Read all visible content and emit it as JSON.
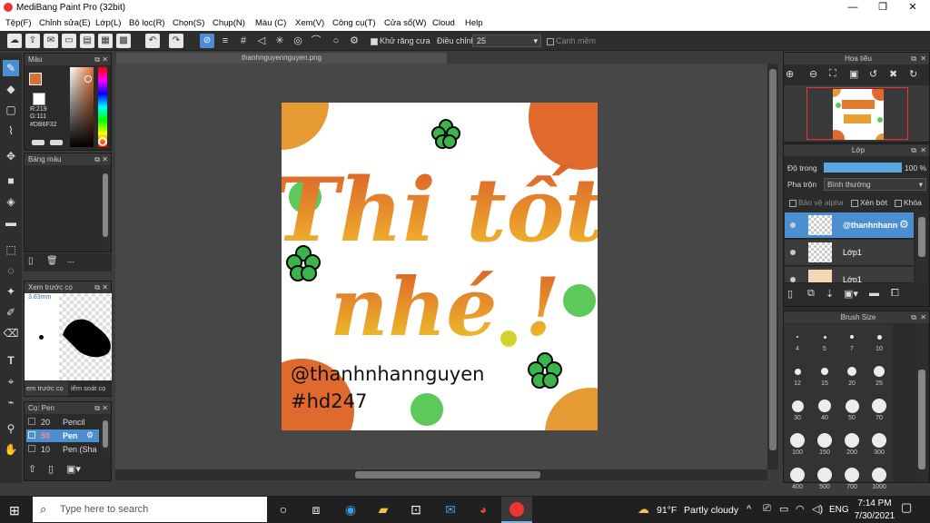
{
  "window": {
    "title": "MediBang Paint Pro (32bit)",
    "min": "—",
    "max": "❐",
    "close": "✕"
  },
  "menu": [
    "Tệp(F)",
    "Chỉnh sửa(E)",
    "Lớp(L)",
    "Bộ lọc(R)",
    "Chọn(S)",
    "Chụp(N)",
    "Màu (C)",
    "Xem(V)",
    "Công cụ(T)",
    "Cửa sổ(W)",
    "Cloud",
    "Help"
  ],
  "toolbar": {
    "antialias": "Khử răng cưa",
    "adjust_label": "Điều chỉnh",
    "adjust_value": "25",
    "edge": "Cạnh mềm"
  },
  "color_panel": {
    "title": "Màu",
    "r": "R:219",
    "g": "G:111",
    "hex": "#DB6F32",
    "fg": "#db6f32"
  },
  "swatch_panel": {
    "title": "Bảng màu",
    "dash": "---"
  },
  "brush_preview": {
    "title": "Xem trước cọ",
    "size": "3.63mm",
    "tab1": "em trước cọ",
    "tab2": "iểm soát cọ"
  },
  "brush_list": {
    "title": "Cọ: Pen",
    "items": [
      {
        "size": "20",
        "name": "Pencil"
      },
      {
        "size": "50",
        "name": "Pen"
      },
      {
        "size": "10",
        "name": "Pen (Sha"
      }
    ]
  },
  "document": {
    "tab": "thanhnguyennguyen.png",
    "art_line1": "Thi tốt",
    "art_line2": "nhé !",
    "handle": "@thanhnhannguyen",
    "tag": "#hd247"
  },
  "navigator": {
    "title": "Hoa tiêu"
  },
  "layers": {
    "title": "Lớp",
    "opacity_label": "Độ trong",
    "opacity_value": "100 %",
    "opacity": 1.0,
    "blend_label": "Pha trộn",
    "blend_value": "Bình thường",
    "protect_alpha": "Bảo vệ alpha",
    "clipping": "Xén bớt",
    "lock": "Khóa",
    "rows": [
      "@thanhnhann",
      "Lớp1",
      "Lớp1"
    ]
  },
  "brush_size": {
    "title": "Brush Size",
    "sizes": [
      "4",
      "5",
      "7",
      "10",
      "12",
      "15",
      "20",
      "25",
      "30",
      "40",
      "50",
      "70",
      "100",
      "150",
      "200",
      "300",
      "400",
      "500",
      "700",
      "1000"
    ]
  },
  "taskbar": {
    "search": "Type here to search",
    "weather_temp": "91°F",
    "weather_text": "Partly cloudy",
    "lang": "ENG",
    "time": "7:14 PM",
    "date": "7/30/2021"
  }
}
